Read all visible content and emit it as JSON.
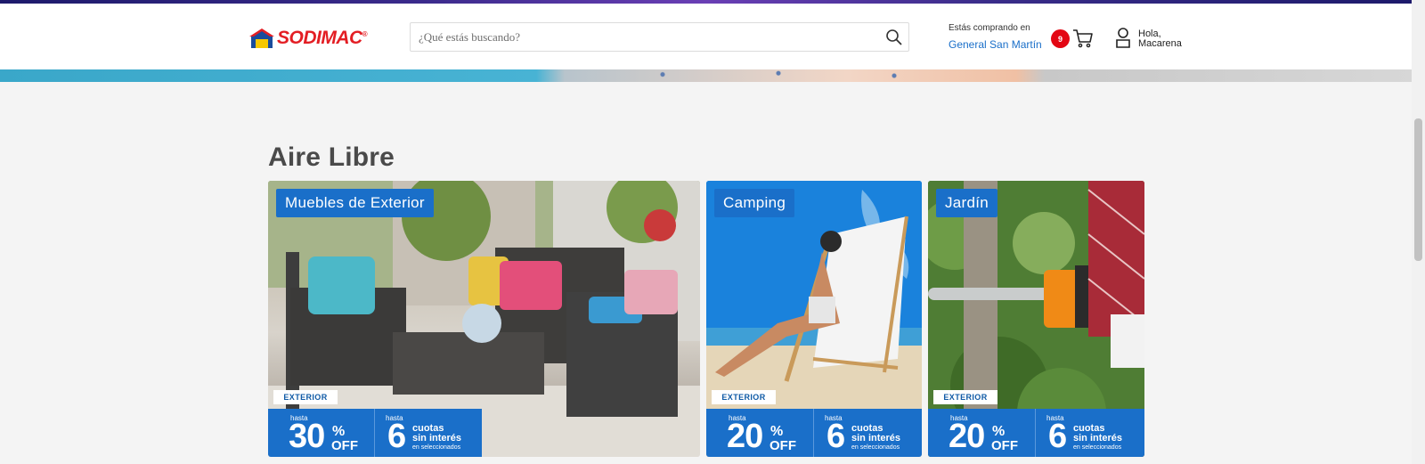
{
  "header": {
    "logo_text": "SODIMAC",
    "logo_reg": "®",
    "search_placeholder": "¿Qué estás buscando?",
    "store_label": "Estás comprando en",
    "store_name": "General San Martín",
    "cart_count": "9",
    "greeting_line1": "Hola,",
    "greeting_line2": "Macarena"
  },
  "section": {
    "title": "Aire Libre",
    "cards": [
      {
        "tag": "Muebles de Exterior",
        "badge": "EXTERIOR",
        "hasta_left": "hasta",
        "percent": "30",
        "percent_sign": "%",
        "off": "OFF",
        "hasta_right": "hasta",
        "installments": "6",
        "cuotas_line1": "cuotas",
        "cuotas_line2": "sin interés",
        "selected": "en seleccionados"
      },
      {
        "tag": "Camping",
        "badge": "EXTERIOR",
        "hasta_left": "hasta",
        "percent": "20",
        "percent_sign": "%",
        "off": "OFF",
        "hasta_right": "hasta",
        "installments": "6",
        "cuotas_line1": "cuotas",
        "cuotas_line2": "sin interés",
        "selected": "en seleccionados"
      },
      {
        "tag": "Jardín",
        "badge": "EXTERIOR",
        "hasta_left": "hasta",
        "percent": "20",
        "percent_sign": "%",
        "off": "OFF",
        "hasta_right": "hasta",
        "installments": "6",
        "cuotas_line1": "cuotas",
        "cuotas_line2": "sin interés",
        "selected": "en seleccionados"
      }
    ]
  },
  "colors": {
    "brand_red": "#e31e24",
    "brand_blue": "#1a6fc9",
    "badge_red": "#e30613"
  },
  "icons": {
    "search": "search-icon",
    "cart": "cart-icon",
    "user": "user-icon",
    "logo": "house-logo-icon"
  }
}
